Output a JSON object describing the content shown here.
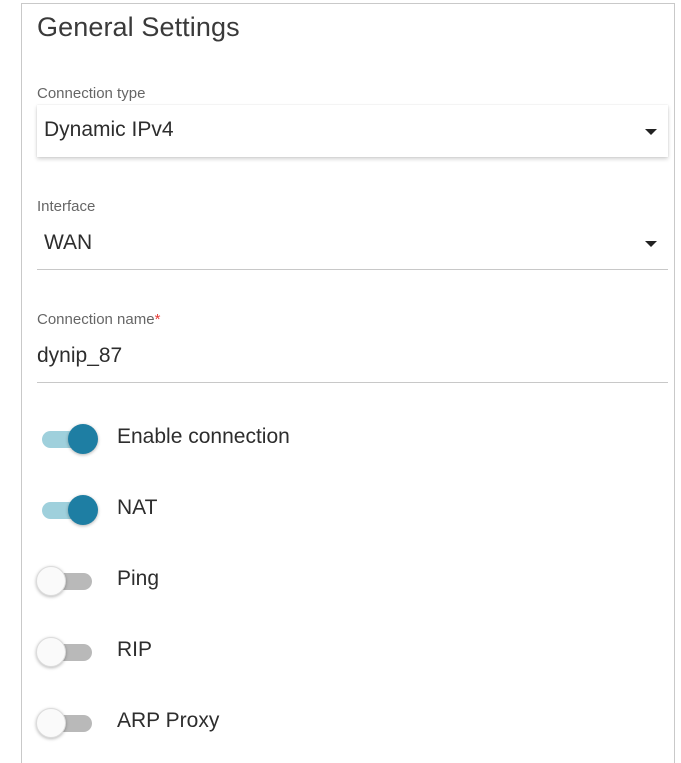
{
  "section": {
    "title": "General Settings"
  },
  "connection_type": {
    "label": "Connection type",
    "value": "Dynamic IPv4"
  },
  "interface": {
    "label": "Interface",
    "value": "WAN"
  },
  "connection_name": {
    "label": "Connection name",
    "required_mark": "*",
    "value": "dynip_87"
  },
  "toggles": [
    {
      "label": "Enable connection",
      "enabled": true
    },
    {
      "label": "NAT",
      "enabled": true
    },
    {
      "label": "Ping",
      "enabled": false
    },
    {
      "label": "RIP",
      "enabled": false
    },
    {
      "label": "ARP Proxy",
      "enabled": false
    }
  ],
  "colors": {
    "toggle_on_knob": "#1e7ea3",
    "toggle_on_track": "#9fd0dc",
    "toggle_off_track": "#b9b9b9",
    "required_mark": "#e53935"
  },
  "icons": {
    "dropdown": "caret-down-icon"
  }
}
